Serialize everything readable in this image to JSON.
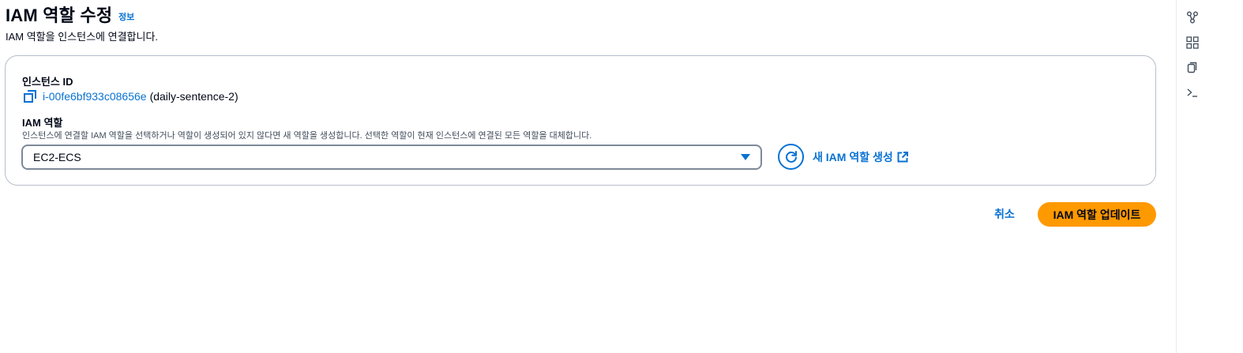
{
  "header": {
    "title": "IAM 역할 수정",
    "info_label": "정보",
    "description": "IAM 역할을 인스턴스에 연결합니다."
  },
  "instance": {
    "label": "인스턴스 ID",
    "id": "i-00fe6bf933c08656e",
    "name": "(daily-sentence-2)"
  },
  "role": {
    "label": "IAM 역할",
    "hint": "인스턴스에 연결할 IAM 역할을 선택하거나 역할이 생성되어 있지 않다면 새 역할을 생성합니다. 선택한 역할이 현재 인스턴스에 연결된 모든 역할을 대체합니다.",
    "selected": "EC2-ECS",
    "new_role_link": "새 IAM 역할 생성"
  },
  "actions": {
    "cancel": "취소",
    "submit": "IAM 역할 업데이트"
  },
  "colors": {
    "link": "#0972d3",
    "primary_button": "#ff9900",
    "border": "#b6bec9",
    "text": "#000716"
  },
  "rail_icons": [
    "share-icon",
    "grid-icon",
    "copy-icon",
    "terminal-icon"
  ]
}
